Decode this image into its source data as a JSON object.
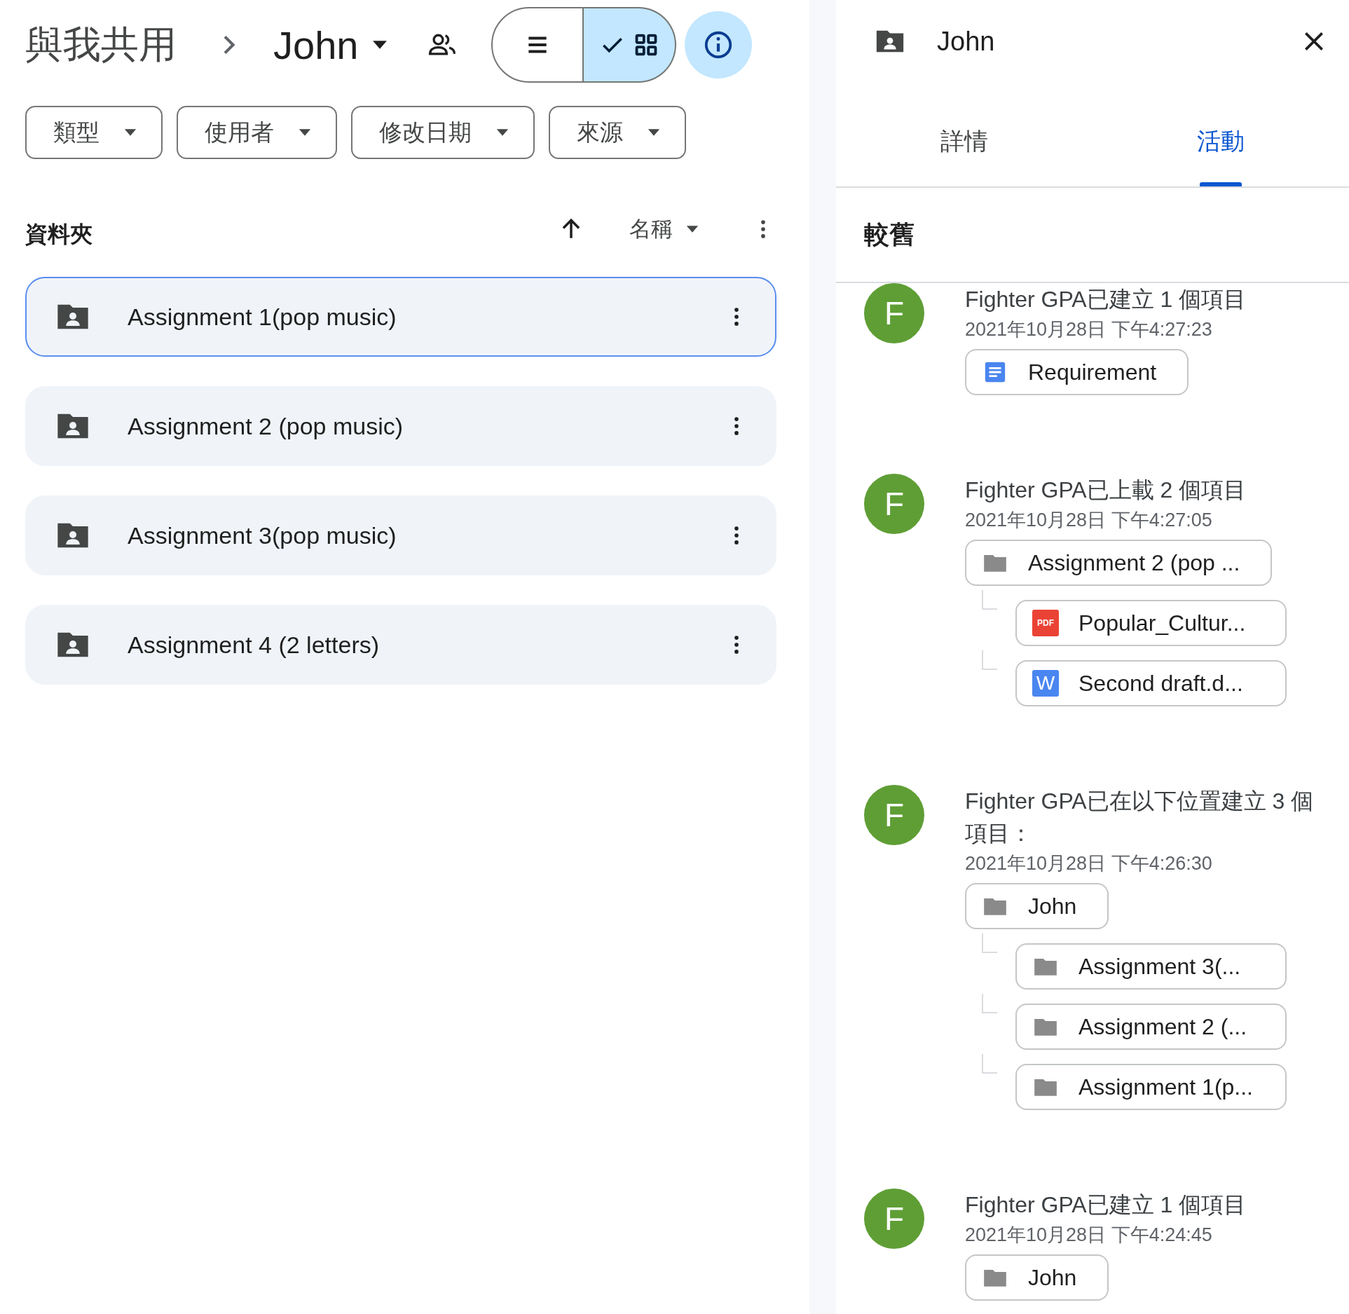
{
  "header": {
    "breadcrumb_root": "與我共用",
    "folder": "John",
    "views": [
      {
        "kind": "list",
        "selected": false
      },
      {
        "kind": "grid",
        "selected": true
      }
    ],
    "details_open": true
  },
  "filters": [
    "類型",
    "使用者",
    "修改日期",
    "來源"
  ],
  "section": {
    "title": "資料夾",
    "sort_label": "名稱"
  },
  "folders": [
    {
      "name": "Assignment 1(pop music)",
      "selected": true
    },
    {
      "name": "Assignment 2 (pop music)",
      "selected": false
    },
    {
      "name": "Assignment 3(pop music)",
      "selected": false
    },
    {
      "name": "Assignment 4 (2 letters)",
      "selected": false
    }
  ],
  "details_panel": {
    "title": "John",
    "tabs": [
      {
        "label": "詳情",
        "selected": false
      },
      {
        "label": "活動",
        "selected": true
      }
    ],
    "group_label": "較舊",
    "activities": [
      {
        "avatar": "F",
        "title": "Fighter GPA已建立 1 個項目",
        "time": "2021年10月28日 下午4:27:23",
        "items": [
          {
            "kind": "doc",
            "name": "Requirement"
          }
        ]
      },
      {
        "avatar": "F",
        "title": "Fighter GPA已上載 2 個項目",
        "time": "2021年10月28日 下午4:27:05",
        "items": [
          {
            "kind": "folder",
            "name": "Assignment 2 (pop ...",
            "children": [
              {
                "kind": "pdf",
                "badge": "PDF",
                "name": "Popular_Cultur..."
              },
              {
                "kind": "word",
                "badge": "W",
                "name": "Second draft.d..."
              }
            ]
          }
        ]
      },
      {
        "avatar": "F",
        "title": "Fighter GPA已在以下位置建立 3 個項目：",
        "time": "2021年10月28日 下午4:26:30",
        "items": [
          {
            "kind": "folder",
            "name": "John",
            "children": [
              {
                "kind": "folder",
                "name": "Assignment 3(..."
              },
              {
                "kind": "folder",
                "name": "Assignment 2 (..."
              },
              {
                "kind": "folder",
                "name": "Assignment 1(p..."
              }
            ]
          }
        ]
      },
      {
        "avatar": "F",
        "title": "Fighter GPA已建立 1 個項目",
        "time": "2021年10月28日 下午4:24:45",
        "items": [
          {
            "kind": "folder",
            "name": "John"
          }
        ]
      }
    ]
  }
}
